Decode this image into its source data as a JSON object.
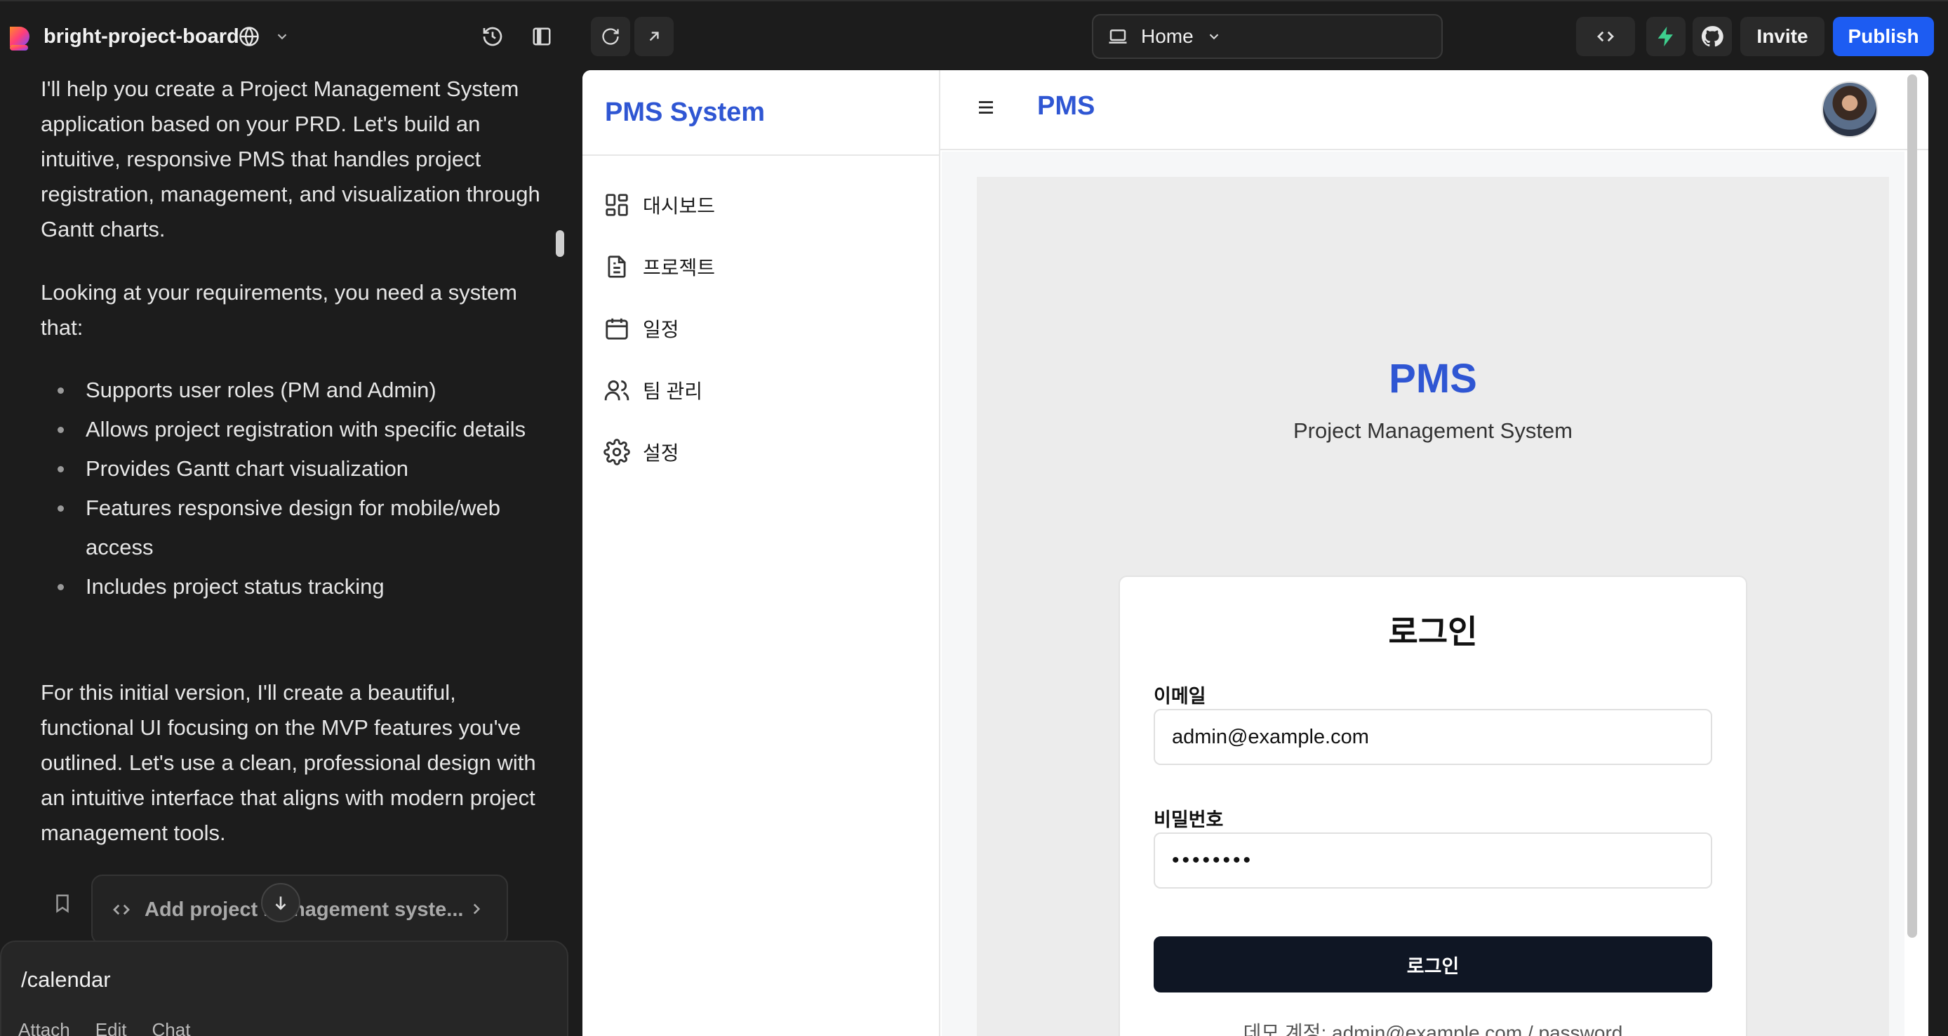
{
  "topbar": {
    "project_name": "bright-project-board",
    "route_label": "Home",
    "invite_label": "Invite",
    "publish_label": "Publish",
    "publish_color": "#1d5cf2",
    "icons": [
      "logo-mark",
      "globe-icon",
      "chevron-down-icon",
      "history-icon",
      "sidebar-toggle-icon",
      "refresh-icon",
      "external-link-icon",
      "laptop-icon",
      "code-icon",
      "bolt-icon",
      "github-icon"
    ]
  },
  "chat": {
    "paragraph1": "I'll help you create a Project Management System application based on your PRD. Let's build an intuitive, responsive PMS that handles project registration, management, and visualization through Gantt charts.",
    "paragraph2": "Looking at your requirements, you need a system that:",
    "bullets": [
      "Supports user roles (PM and Admin)",
      "Allows project registration with specific details",
      "Provides Gantt chart visualization",
      "Features responsive design for mobile/web access",
      "Includes project status tracking"
    ],
    "paragraph3": "For this initial version, I'll create a beautiful, functional UI focusing on the MVP features you've outlined. Let's use a clean, professional design with an intuitive interface that aligns with modern project management tools.",
    "commit_label": "Add project management syste...",
    "composer_value": "/calendar",
    "composer_tools": {
      "attach": "Attach",
      "edit": "Edit",
      "chat": "Chat"
    }
  },
  "app": {
    "brand": "PMS System",
    "accent_color": "#2f56d3",
    "nav": [
      {
        "label": "대시보드",
        "icon": "dashboard-icon"
      },
      {
        "label": "프로젝트",
        "icon": "document-icon"
      },
      {
        "label": "일정",
        "icon": "calendar-icon"
      },
      {
        "label": "팀 관리",
        "icon": "users-icon"
      },
      {
        "label": "설정",
        "icon": "gear-icon"
      }
    ],
    "header_title": "PMS",
    "login": {
      "hero_title": "PMS",
      "hero_subtitle": "Project Management System",
      "card_title": "로그인",
      "email_label": "이메일",
      "email_value": "admin@example.com",
      "password_label": "비밀번호",
      "password_value": "password",
      "submit_label": "로그인",
      "demo_hint": "데모 계정: admin@example.com / password"
    }
  }
}
